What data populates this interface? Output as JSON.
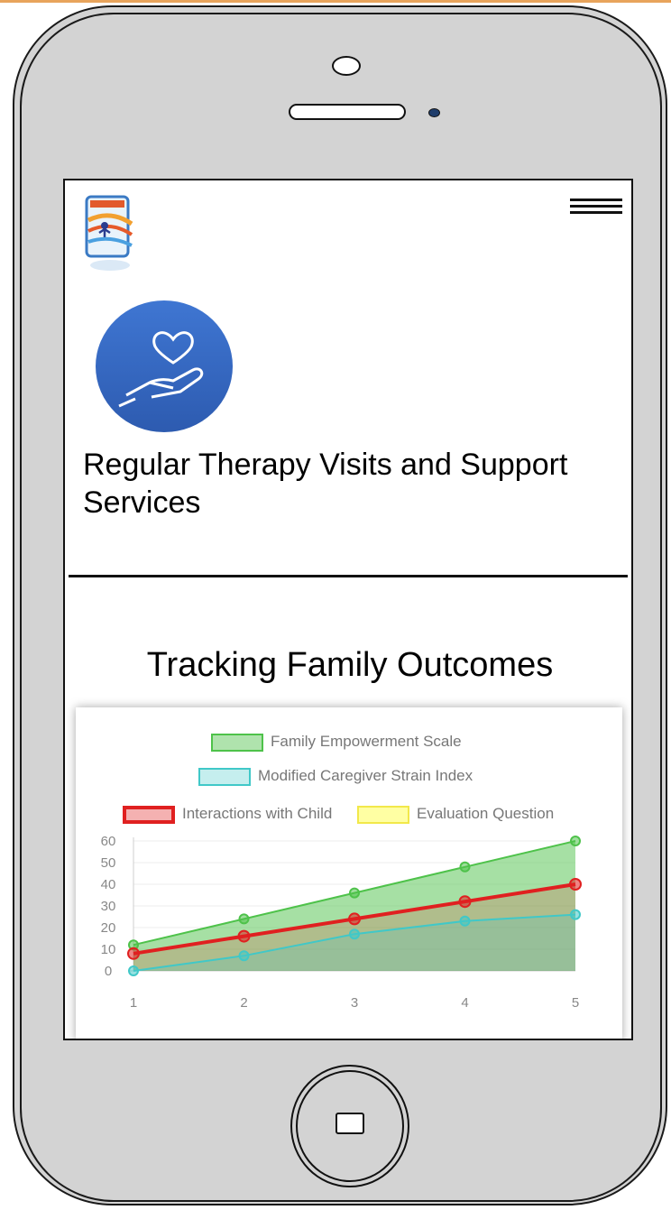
{
  "service": {
    "title": "Regular Therapy Visits and Support Services"
  },
  "section": {
    "title": "Tracking Family Outcomes"
  },
  "icons": {
    "menu": "hamburger-menu-icon",
    "service": "heart-in-hand-icon",
    "home": "home-button-icon"
  },
  "colors": {
    "phone_body": "#d3d3d3",
    "service_icon": "#3a6cc4",
    "empowerment": "#4ec24a",
    "strain": "#40c8c8",
    "interactions": "#e02020",
    "evaluation": "#ffff66"
  },
  "chart_data": {
    "type": "area",
    "x": [
      1,
      2,
      3,
      4,
      5
    ],
    "ylim": [
      0,
      60
    ],
    "yticks": [
      "60",
      "50",
      "40",
      "30",
      "20",
      "10",
      "0"
    ],
    "xticks": [
      "1",
      "2",
      "3",
      "4",
      "5"
    ],
    "legend_position": "top",
    "series": [
      {
        "name": "Family Empowerment Scale",
        "values": [
          12,
          24,
          36,
          48,
          60
        ],
        "color": "#4ec24a"
      },
      {
        "name": "Modified Caregiver Strain Index",
        "values": [
          0,
          7,
          17,
          23,
          26
        ],
        "color": "#40c8c8"
      },
      {
        "name": "Interactions with Child",
        "values": [
          8,
          16,
          24,
          32,
          40
        ],
        "color": "#e02020"
      },
      {
        "name": "Evaluation Question",
        "values": [],
        "color": "#ffff66"
      }
    ]
  }
}
